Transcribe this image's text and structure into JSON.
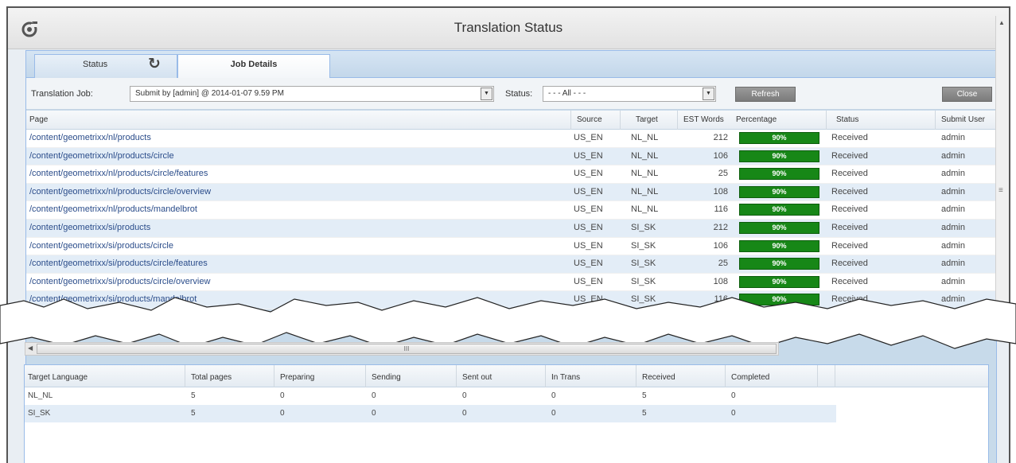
{
  "window": {
    "title": "Translation Status",
    "logo_icon": "refresh-target-icon"
  },
  "tabs": {
    "status": "Status",
    "job_details": "Job Details",
    "refresh_icon": "refresh-icon"
  },
  "toolbar": {
    "job_label": "Translation Job:",
    "job_value": "Submit by [admin] @ 2014-01-07 9.59 PM",
    "status_label": "Status:",
    "status_value": "- - - All - - -",
    "refresh_button": "Refresh",
    "close_button": "Close"
  },
  "grid": {
    "columns": {
      "page": "Page",
      "source": "Source",
      "target": "Target",
      "est_words": "EST Words",
      "percentage": "Percentage",
      "status": "Status",
      "submit_user": "Submit User"
    },
    "rows": [
      {
        "page": "/content/geometrixx/nl/products",
        "source": "US_EN",
        "target": "NL_NL",
        "est_words": "212",
        "percentage": "90%",
        "status": "Received",
        "user": "admin"
      },
      {
        "page": "/content/geometrixx/nl/products/circle",
        "source": "US_EN",
        "target": "NL_NL",
        "est_words": "106",
        "percentage": "90%",
        "status": "Received",
        "user": "admin"
      },
      {
        "page": "/content/geometrixx/nl/products/circle/features",
        "source": "US_EN",
        "target": "NL_NL",
        "est_words": "25",
        "percentage": "90%",
        "status": "Received",
        "user": "admin"
      },
      {
        "page": "/content/geometrixx/nl/products/circle/overview",
        "source": "US_EN",
        "target": "NL_NL",
        "est_words": "108",
        "percentage": "90%",
        "status": "Received",
        "user": "admin"
      },
      {
        "page": "/content/geometrixx/nl/products/mandelbrot",
        "source": "US_EN",
        "target": "NL_NL",
        "est_words": "116",
        "percentage": "90%",
        "status": "Received",
        "user": "admin"
      },
      {
        "page": "/content/geometrixx/si/products",
        "source": "US_EN",
        "target": "SI_SK",
        "est_words": "212",
        "percentage": "90%",
        "status": "Received",
        "user": "admin"
      },
      {
        "page": "/content/geometrixx/si/products/circle",
        "source": "US_EN",
        "target": "SI_SK",
        "est_words": "106",
        "percentage": "90%",
        "status": "Received",
        "user": "admin"
      },
      {
        "page": "/content/geometrixx/si/products/circle/features",
        "source": "US_EN",
        "target": "SI_SK",
        "est_words": "25",
        "percentage": "90%",
        "status": "Received",
        "user": "admin"
      },
      {
        "page": "/content/geometrixx/si/products/circle/overview",
        "source": "US_EN",
        "target": "SI_SK",
        "est_words": "108",
        "percentage": "90%",
        "status": "Received",
        "user": "admin"
      },
      {
        "page": "/content/geometrixx/si/products/mandelbrot",
        "source": "US_EN",
        "target": "SI_SK",
        "est_words": "116",
        "percentage": "90%",
        "status": "Received",
        "user": "admin"
      }
    ],
    "hscroll_grip": "III"
  },
  "summary": {
    "columns": {
      "target_language": "Target Language",
      "total_pages": "Total pages",
      "preparing": "Preparing",
      "sending": "Sending",
      "sent_out": "Sent out",
      "in_trans": "In Trans",
      "received": "Received",
      "completed": "Completed"
    },
    "rows": [
      {
        "target_language": "NL_NL",
        "total_pages": "5",
        "preparing": "0",
        "sending": "0",
        "sent_out": "0",
        "in_trans": "0",
        "received": "5",
        "completed": "0"
      },
      {
        "target_language": "SI_SK",
        "total_pages": "5",
        "preparing": "0",
        "sending": "0",
        "sent_out": "0",
        "in_trans": "0",
        "received": "5",
        "completed": "0"
      }
    ]
  },
  "colors": {
    "progress": "#178717",
    "header_bg": "#c7daea",
    "alt_row": "#e3edf7"
  }
}
